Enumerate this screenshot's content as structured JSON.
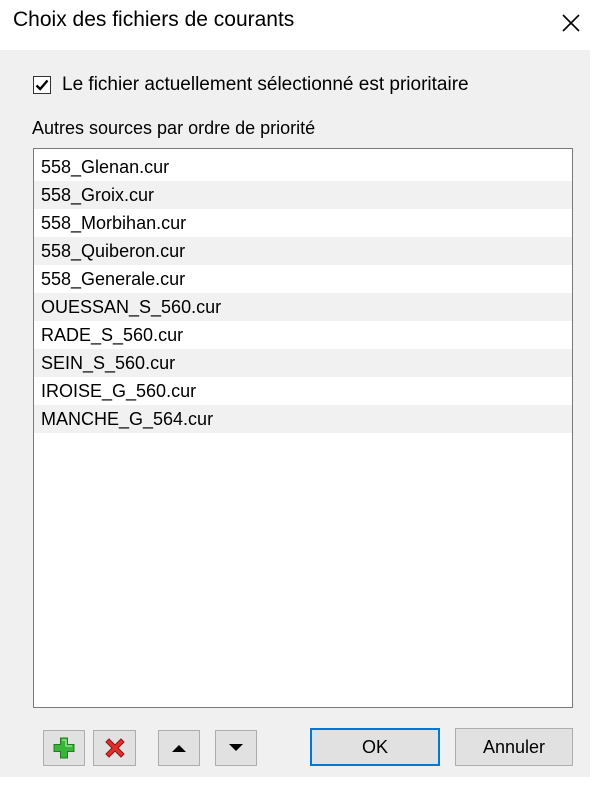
{
  "window": {
    "title": "Choix des fichiers de courants"
  },
  "options": {
    "priority_checkbox_label": "Le fichier actuellement sélectionné est prioritaire",
    "priority_checked": true
  },
  "sources": {
    "group_label": "Autres sources par ordre de priorité",
    "files": [
      "558_Glenan.cur",
      "558_Groix.cur",
      "558_Morbihan.cur",
      "558_Quiberon.cur",
      "558_Generale.cur",
      "OUESSAN_S_560.cur",
      "RADE_S_560.cur",
      "SEIN_S_560.cur",
      "IROISE_G_560.cur",
      "MANCHE_G_564.cur"
    ]
  },
  "toolbar": {
    "add_icon": "plus-icon",
    "remove_icon": "x-icon",
    "up_icon": "triangle-up-icon",
    "down_icon": "triangle-down-icon"
  },
  "buttons": {
    "ok_label": "OK",
    "cancel_label": "Annuler"
  },
  "colors": {
    "add_green": "#3bb43b",
    "remove_red": "#e0302a",
    "default_button_border": "#0078d7"
  }
}
